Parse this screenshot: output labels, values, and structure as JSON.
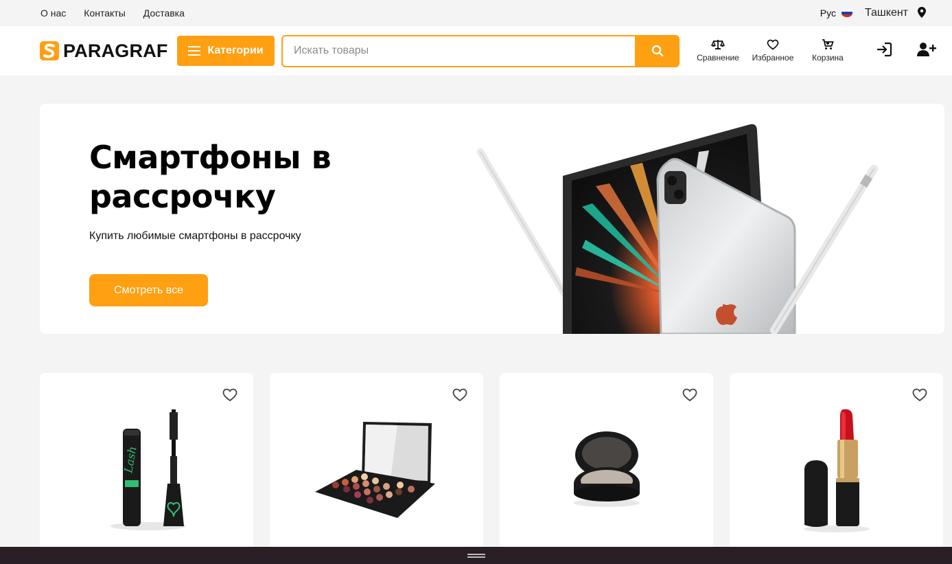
{
  "topbar": {
    "links": [
      "О нас",
      "Контакты",
      "Доставка"
    ],
    "language": "Рус",
    "city": "Ташкент"
  },
  "header": {
    "logo_text": "PARAGRAF",
    "categories_label": "Категории",
    "search_placeholder": "Искать товары",
    "compare_label": "Сравнение",
    "favorites_label": "Избранное",
    "cart_label": "Корзина"
  },
  "banner": {
    "title": "Смартфоны в рассрочку",
    "subtitle": "Купить любимые смартфоны в рассрочку",
    "cta_label": "Смотреть все"
  },
  "products": [
    {
      "icon": "mascara-image"
    },
    {
      "icon": "eyeshadow-palette-image"
    },
    {
      "icon": "compact-powder-image"
    },
    {
      "icon": "lipstick-image"
    }
  ],
  "colors": {
    "accent": "#ff9f12",
    "background": "#f4f4f4",
    "bottom_bar": "#2a1f26"
  }
}
